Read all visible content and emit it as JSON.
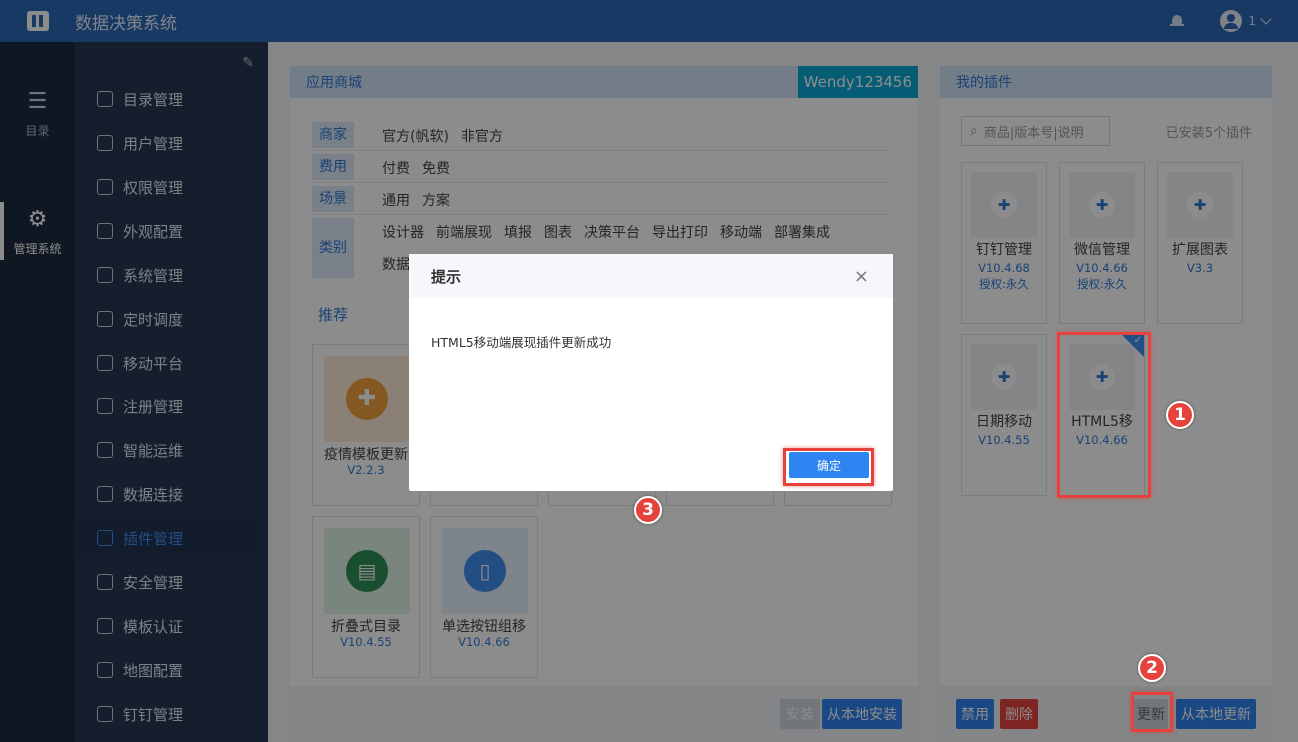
{
  "app": {
    "title": "数据决策系统",
    "user": "1"
  },
  "rail": [
    {
      "label": "目录",
      "icon": "list-icon"
    },
    {
      "label": "管理系统",
      "icon": "gear-icon"
    }
  ],
  "sidebar": {
    "items": [
      {
        "label": "目录管理"
      },
      {
        "label": "用户管理"
      },
      {
        "label": "权限管理"
      },
      {
        "label": "外观配置"
      },
      {
        "label": "系统管理"
      },
      {
        "label": "定时调度"
      },
      {
        "label": "移动平台"
      },
      {
        "label": "注册管理"
      },
      {
        "label": "智能运维"
      },
      {
        "label": "数据连接"
      },
      {
        "label": "插件管理"
      },
      {
        "label": "安全管理"
      },
      {
        "label": "模板认证"
      },
      {
        "label": "地图配置"
      },
      {
        "label": "钉钉管理"
      }
    ],
    "active_index": 10
  },
  "store": {
    "title": "应用商城",
    "account": "Wendy123456",
    "filters": [
      {
        "key": "商家",
        "values": [
          "官方(帆软)",
          "非官方"
        ]
      },
      {
        "key": "费用",
        "values": [
          "付费",
          "免费"
        ]
      },
      {
        "key": "场景",
        "values": [
          "通用",
          "方案"
        ]
      },
      {
        "key": "类别",
        "values": [
          "设计器",
          "前端展现",
          "填报",
          "图表",
          "决策平台",
          "导出打印",
          "移动端",
          "部署集成"
        ],
        "values2": [
          "数据"
        ]
      }
    ],
    "recommend_label": "推荐",
    "cards": [
      {
        "name": "疫情模板更新",
        "version": "V2.2.3"
      },
      {
        "name": "折叠式目录",
        "version": "V10.4.55"
      },
      {
        "name": "单选按钮组移",
        "version": "V10.4.66"
      }
    ],
    "install_button": "安装",
    "local_install_button": "从本地安装"
  },
  "my_plugins": {
    "title": "我的插件",
    "search_placeholder": "商品|版本号|说明",
    "installed_count": "已安装5个插件",
    "cards": [
      {
        "name": "钉钉管理",
        "version": "V10.4.68",
        "license": "授权:永久"
      },
      {
        "name": "微信管理",
        "version": "V10.4.66",
        "license": "授权:永久"
      },
      {
        "name": "扩展图表",
        "version": "V3.3",
        "license": ""
      },
      {
        "name": "日期移动",
        "version": "V10.4.55",
        "license": ""
      },
      {
        "name": "HTML5移",
        "version": "V10.4.66",
        "license": ""
      }
    ],
    "buttons": {
      "disable": "禁用",
      "delete": "删除",
      "update": "更新",
      "local_update": "从本地更新"
    }
  },
  "modal": {
    "title": "提示",
    "close": "×",
    "message": "HTML5移动端展现插件更新成功",
    "ok": "确定"
  },
  "markers": [
    "1",
    "2",
    "3"
  ],
  "colors": {
    "accent": "#2e84f0",
    "highlight": "#e5423e",
    "topbar": "#2f68b8"
  }
}
